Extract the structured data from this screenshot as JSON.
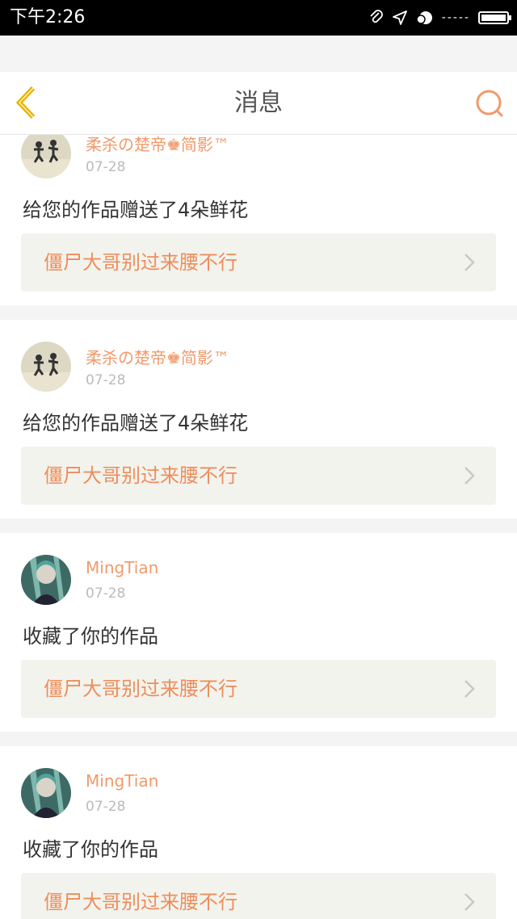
{
  "status_bar": {
    "time": "下午2:26",
    "signal": "-----"
  },
  "header": {
    "title": "消息"
  },
  "theme": {
    "accent": "#f19a6b",
    "back_icon_color": "#e8b100",
    "card_bg": "#f3f3ed"
  },
  "notifications": [
    {
      "avatar_icon": "avatar-jumping-couple-icon",
      "username": "柔杀の楚帝♚简影™",
      "date": "07-28",
      "action": "给您的作品赠送了4朵鲜花",
      "work_title": "僵尸大哥别过来腰不行"
    },
    {
      "avatar_icon": "avatar-jumping-couple-icon",
      "username": "柔杀の楚帝♚简影™",
      "date": "07-28",
      "action": "给您的作品赠送了4朵鲜花",
      "work_title": "僵尸大哥别过来腰不行"
    },
    {
      "avatar_icon": "avatar-anime-character-icon",
      "username": "MingTian",
      "date": "07-28",
      "action": "收藏了你的作品",
      "work_title": "僵尸大哥别过来腰不行"
    },
    {
      "avatar_icon": "avatar-anime-character-icon",
      "username": "MingTian",
      "date": "07-28",
      "action": "收藏了你的作品",
      "work_title": "僵尸大哥别过来腰不行"
    }
  ]
}
